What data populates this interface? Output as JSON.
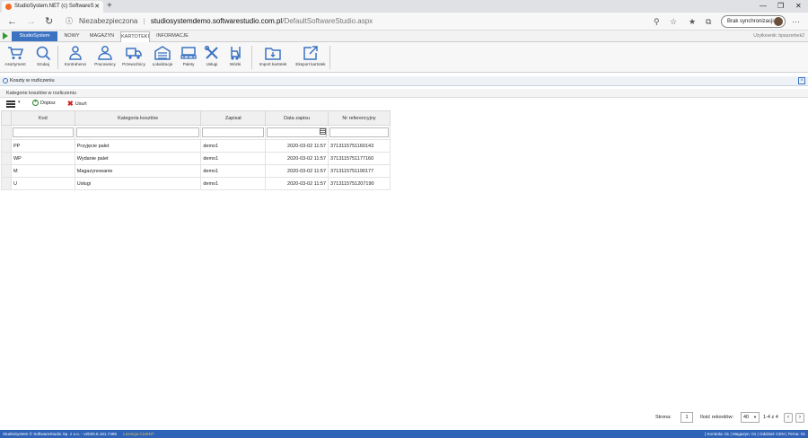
{
  "browser": {
    "tab_title": "StudioSystem.NET (c) SoftwareS",
    "new_tab": "+",
    "url_security": "Niezabezpieczona",
    "url_host": "studiosystemdemo.softwarestudio.com.pl",
    "url_path": "/DefaultSoftwareStudio.aspx",
    "sync_label": "Brak synchronizacji"
  },
  "app": {
    "app_button": "StudioSystem",
    "menu_tabs": [
      "NOWY",
      "MAGAZYN",
      "KARTOTEKI",
      "INFORMACJE"
    ],
    "active_tab": "KARTOTEKI",
    "user": "Użytkownik: bpaszerbek2"
  },
  "ribbon": [
    {
      "label": "Asortyment",
      "icon": "cart-icon"
    },
    {
      "label": "Szukaj",
      "icon": "search-icon"
    },
    {
      "label": "Kontrahenci",
      "icon": "contractors-icon"
    },
    {
      "label": "Pracownicy",
      "icon": "employee-icon"
    },
    {
      "label": "Przewoźnicy",
      "icon": "truck-icon"
    },
    {
      "label": "Lokalizacje",
      "icon": "warehouse-icon"
    },
    {
      "label": "Palety",
      "icon": "pallet-icon"
    },
    {
      "label": "Usługi",
      "icon": "tools-icon"
    },
    {
      "label": "Wózki",
      "icon": "forklift-icon"
    },
    {
      "label": "Import kartotek",
      "icon": "import-folder-icon"
    },
    {
      "label": "Eksport kartotek",
      "icon": "export-icon"
    }
  ],
  "module": {
    "title": "Koszty w rozliczeniu",
    "subtitle": "Kategorie kosztów w rozliczeniu"
  },
  "toolbar": {
    "add_label": "Dopisz",
    "delete_label": "Usuń"
  },
  "grid": {
    "columns": [
      "Kod",
      "Kategoria kosztów",
      "Zapisał",
      "Data zapisu",
      "Nr referencyjny"
    ],
    "rows": [
      [
        "PP",
        "Przyjęcie palet",
        "demo1",
        "2020-03-02 11:57",
        "3713115751160143"
      ],
      [
        "WP",
        "Wydanie palet",
        "demo1",
        "2020-03-02 11:57",
        "3713115751177160"
      ],
      [
        "M",
        "Magazynowanie",
        "demo1",
        "2020-03-02 11:57",
        "3713115751190177"
      ],
      [
        "U",
        "Usługi",
        "demo1",
        "2020-03-02 11:57",
        "3713115751207190"
      ]
    ]
  },
  "pager": {
    "page_label": "Strona:",
    "page": "1",
    "records_label": "Ilość rekordów:",
    "records": "40",
    "range": "1-4 z 4"
  },
  "status": {
    "left": "StudioSystem © SoftwareStudio Sp. z o.o. - v2020.6.161.7465",
    "license": "Licencja CLIENT",
    "right": "| Kontrola: 01 | Magazyn: 01 | Oddział: CEN | Firma: 01"
  }
}
